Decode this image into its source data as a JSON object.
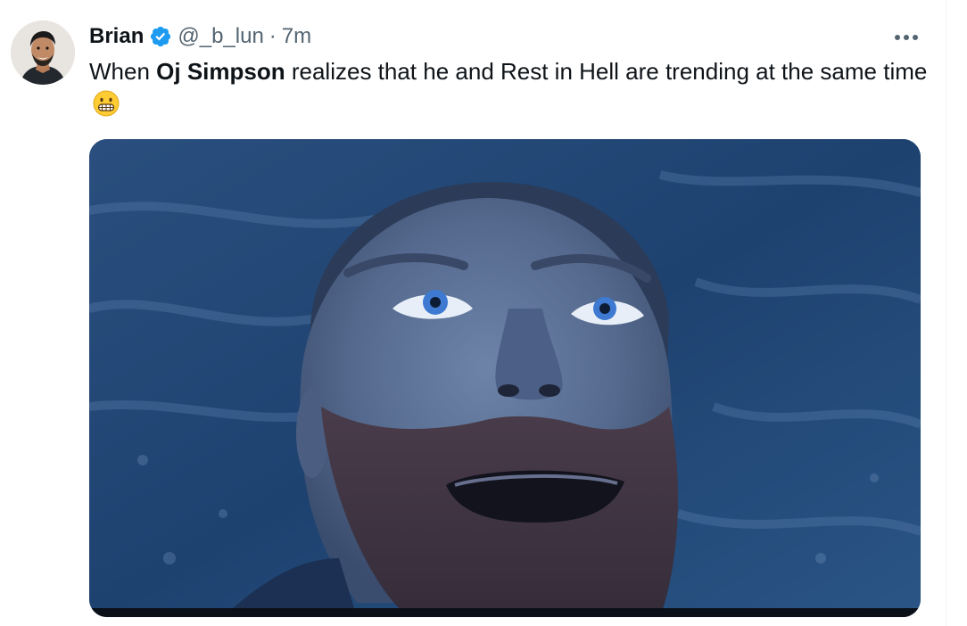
{
  "author": {
    "name": "Brian",
    "handle": "@_b_lun",
    "separator": "·",
    "time": "7m",
    "verified": true
  },
  "post": {
    "text_before": "When ",
    "text_bold": "Oj Simpson",
    "text_after": " realizes that he and Rest in Hell are trending at the same time",
    "emoji": "grimacing-face"
  },
  "media": {
    "kind": "image",
    "description_icon": "photo",
    "tint": "#1d3e66"
  },
  "icons": {
    "verified": "verified-badge-icon",
    "more": "more-options-icon"
  },
  "colors": {
    "text": "#0f1419",
    "secondary": "#536471",
    "verified": "#1d9bf0"
  }
}
